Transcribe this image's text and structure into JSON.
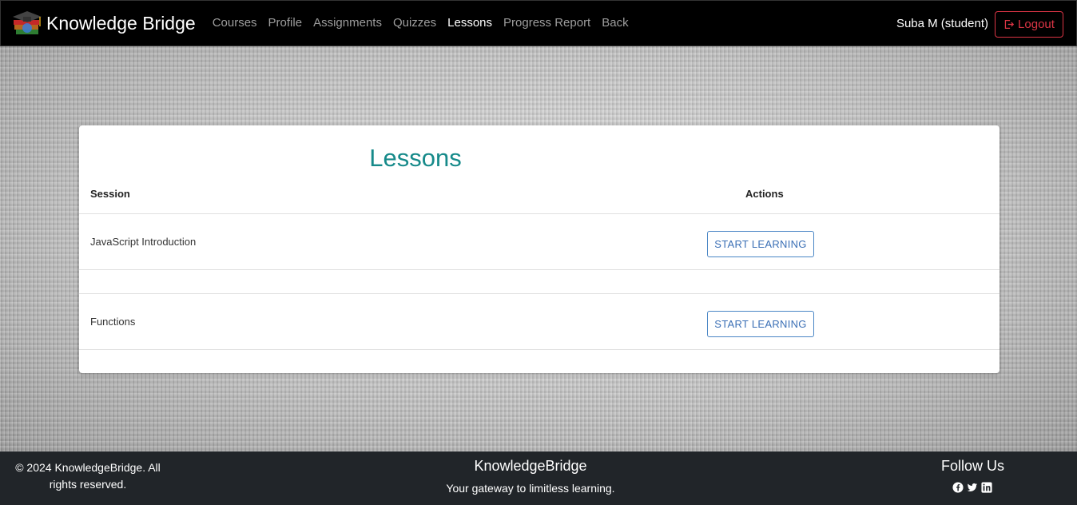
{
  "navbar": {
    "brand": "Knowledge Bridge",
    "links": [
      "Courses",
      "Profile",
      "Assignments",
      "Quizzes",
      "Lessons",
      "Progress Report",
      "Back"
    ],
    "active": "Lessons",
    "user": "Suba M (student)",
    "logout_label": "Logout"
  },
  "lessons": {
    "title": "Lessons",
    "headers": {
      "session": "Session",
      "actions": "Actions"
    },
    "rows": [
      {
        "session": "JavaScript Introduction",
        "action_label": "START LEARNING"
      },
      {
        "session": "Functions",
        "action_label": "START LEARNING"
      }
    ]
  },
  "footer": {
    "copyright": "© 2024 KnowledgeBridge. All rights reserved.",
    "brand": "KnowledgeBridge",
    "tagline": "Your gateway to limitless learning.",
    "follow": "Follow Us",
    "social_icons": [
      "facebook-icon",
      "twitter-icon",
      "linkedin-icon"
    ]
  },
  "colors": {
    "accent": "#168a8a",
    "logout": "#dc3545",
    "button": "#3a6fb5",
    "footer_bg": "#212529"
  }
}
